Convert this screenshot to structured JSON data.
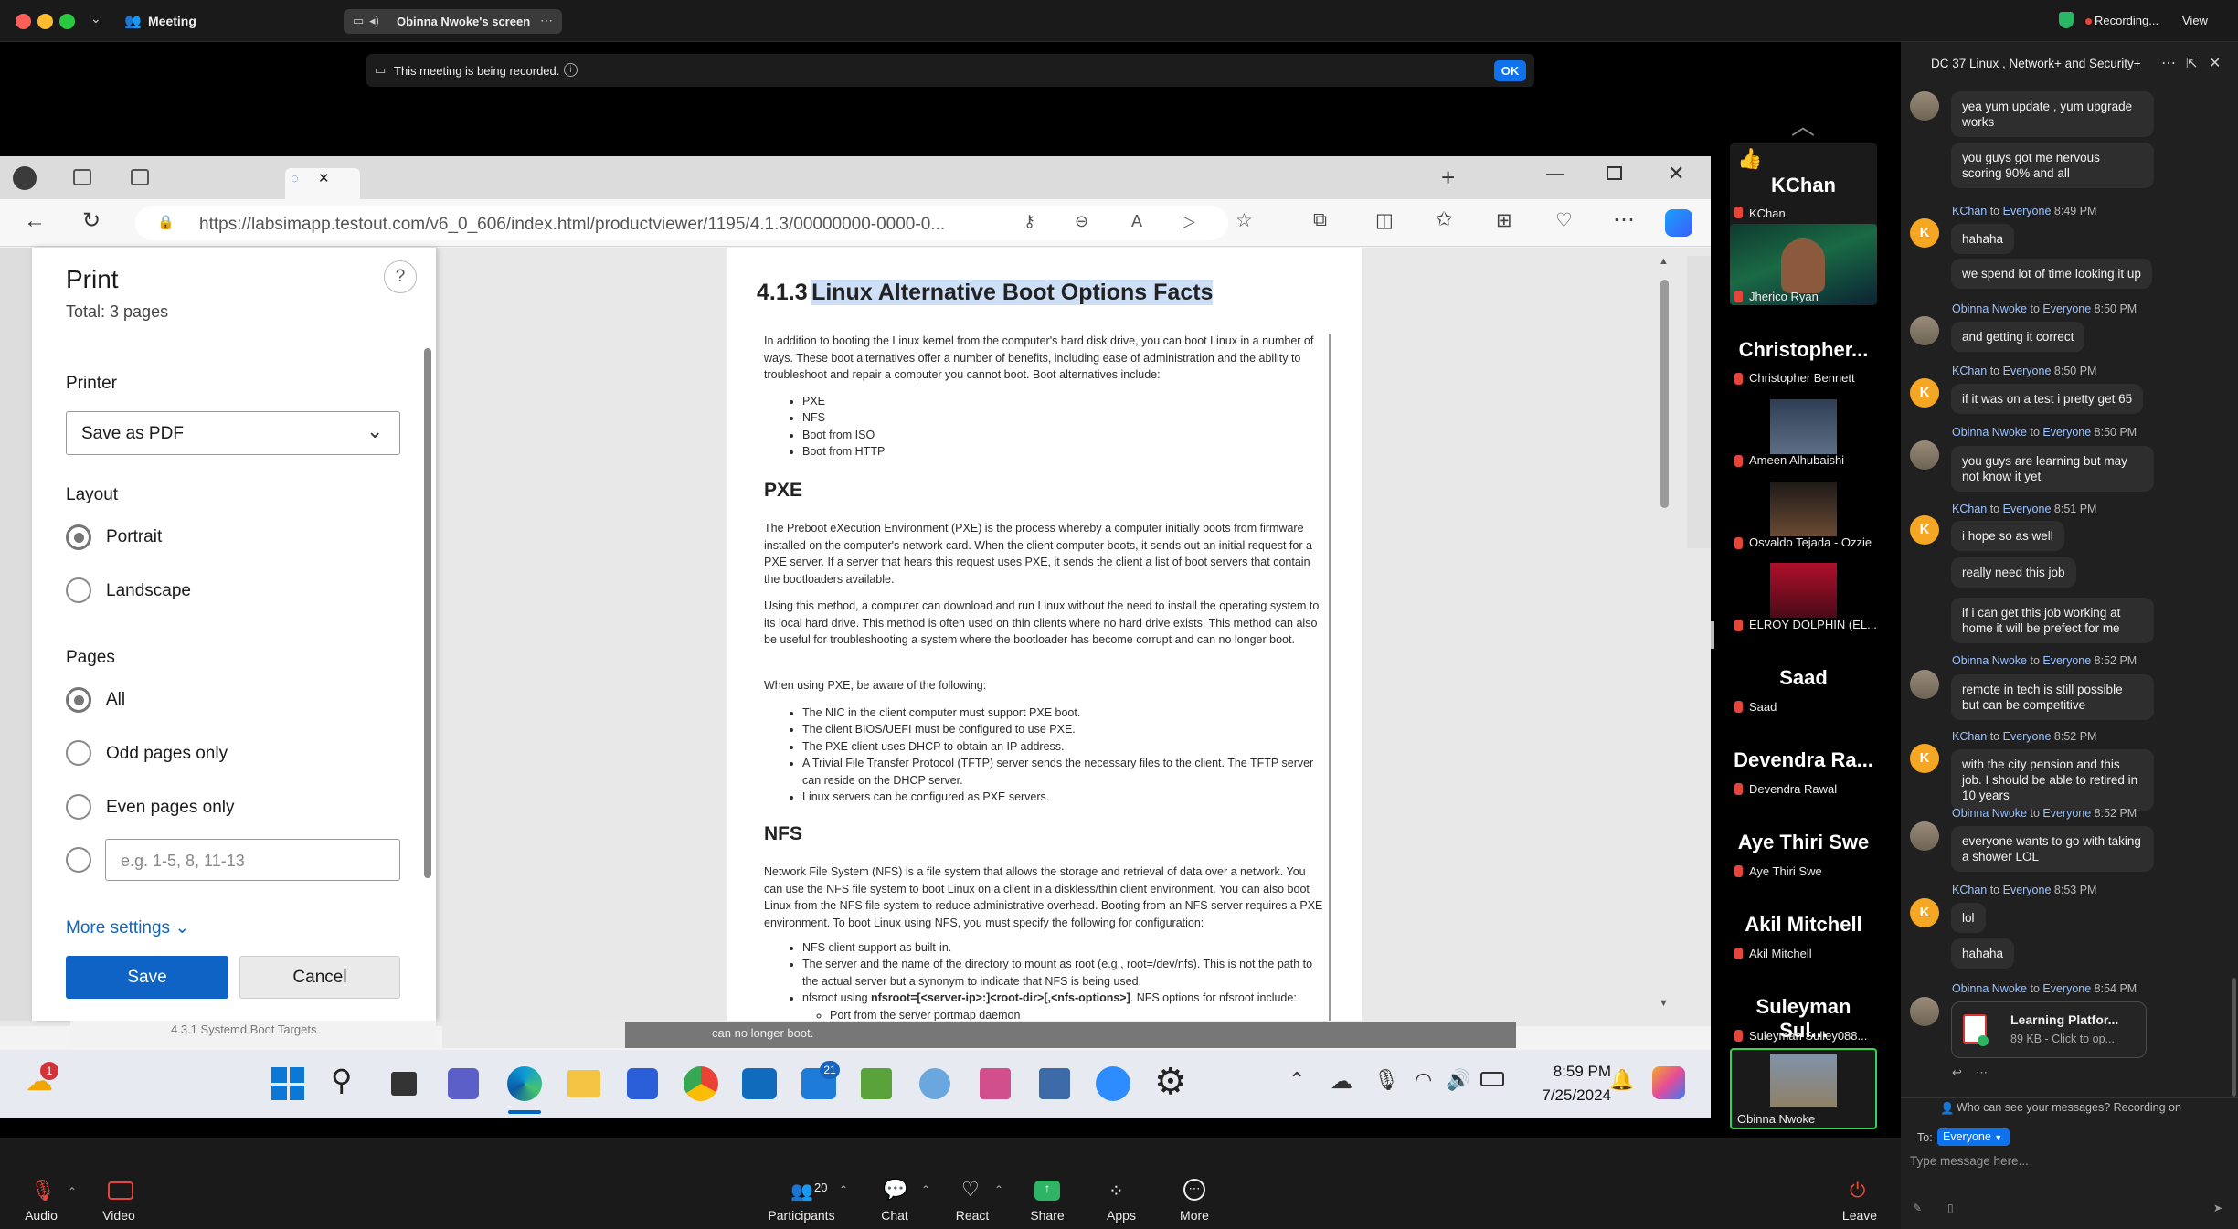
{
  "topbar": {
    "title": "Meeting",
    "share_label": "Obinna Nwoke's screen",
    "recording": "Recording...",
    "view": "View"
  },
  "banner": {
    "text": "This meeting is being recorded.",
    "ok": "OK"
  },
  "browser": {
    "url": "https://labsimapp.testout.com/v6_0_606/index.html/productviewer/1195/4.1.3/00000000-0000-0..."
  },
  "print": {
    "title": "Print",
    "total": "Total: 3 pages",
    "printer_label": "Printer",
    "printer_value": "Save as PDF",
    "layout_label": "Layout",
    "portrait": "Portrait",
    "landscape": "Landscape",
    "pages_label": "Pages",
    "all": "All",
    "odd": "Odd pages only",
    "even": "Even pages only",
    "custom_placeholder": "e.g. 1-5, 8, 11-13",
    "more": "More settings",
    "save": "Save",
    "cancel": "Cancel"
  },
  "doc": {
    "heading_num": "4.1.3",
    "heading": "Linux Alternative Boot Options Facts",
    "intro": "In addition to booting the Linux kernel from the computer's hard disk drive, you can boot Linux in a number of ways. These boot alternatives offer a number of benefits, including ease of administration and the ability to troubleshoot and repair a computer you cannot boot. Boot alternatives include:",
    "intro_list": [
      "PXE",
      "NFS",
      "Boot from ISO",
      "Boot from HTTP"
    ],
    "pxe_h": "PXE",
    "pxe_p1": "The Preboot eXecution Environment (PXE) is the process whereby a computer initially boots from firmware installed on the computer's network card. When the client computer boots, it sends out an initial request for a PXE server. If a server that hears this request uses PXE, it sends the client a list of boot servers that contain the bootloaders available.",
    "pxe_p2": "Using this method, a computer can download and run Linux without the need to install the operating system to its local hard drive. This method is often used on thin clients where no hard drive exists. This method can also be useful for troubleshooting a system where the bootloader has become corrupt and can no longer boot.",
    "pxe_p3": "When using PXE, be aware of the following:",
    "pxe_list": [
      "The NIC in the client computer must support PXE boot.",
      "The client BIOS/UEFI must be configured to use PXE.",
      "The PXE client uses DHCP to obtain an IP address.",
      "A Trivial File Transfer Protocol (TFTP) server sends the necessary files to the client. The TFTP server can reside on the DHCP server.",
      "Linux servers can be configured as PXE servers."
    ],
    "nfs_h": "NFS",
    "nfs_p1": "Network File System (NFS) is a file system that allows the storage and retrieval of data over a network. You can use the NFS file system to boot Linux on a client in a diskless/thin client environment. You can also boot Linux from the NFS file system to reduce administrative overhead. Booting from an NFS server requires a PXE environment. To boot Linux using NFS, you must specify the following for configuration:",
    "nfs_list1": "NFS client support as built-in.",
    "nfs_list2": "The server and the name of the directory to mount as root (e.g., root=/dev/nfs). This is not the path to the actual server but a synonym to indicate that NFS is being used.",
    "nfs_list3a": "nfsroot using ",
    "nfs_list3b": "nfsroot=[<server-ip>:]<root-dir>[,<nfs-options>]",
    "nfs_list3c": ". NFS options for nfsroot include:",
    "nfs_list4": "Port from the server portmap daemon",
    "under_toc": "4.3.1 Systemd Boot Targets",
    "under_text": "can no longer boot."
  },
  "taskbar": {
    "time": "8:59 PM",
    "date": "7/25/2024",
    "weather_badge": "1",
    "outlook_badge": "21"
  },
  "participants": [
    {
      "big": "KChan",
      "small": "KChan"
    },
    {
      "big": "",
      "small": "Jherico Ryan"
    },
    {
      "big": "Christopher...",
      "small": "Christopher Bennett"
    },
    {
      "big": "",
      "small": "Ameen Alhubaishi"
    },
    {
      "big": "",
      "small": "Osvaldo Tejada - Ozzie"
    },
    {
      "big": "",
      "small": "ELROY DOLPHIN (EL..."
    },
    {
      "big": "Saad",
      "small": "Saad"
    },
    {
      "big": "Devendra Ra...",
      "small": "Devendra Rawal"
    },
    {
      "big": "Aye Thiri Swe",
      "small": "Aye Thiri Swe"
    },
    {
      "big": "Akil Mitchell",
      "small": "Akil Mitchell"
    },
    {
      "big": "Suleyman Sul...",
      "small": "Suleyman Sulley088..."
    },
    {
      "big": "",
      "small": "Obinna Nwoke"
    }
  ],
  "chat": {
    "title": "DC 37 Linux , Network+ and Security+",
    "to_word": "to",
    "messages": [
      {
        "text": "yea yum update , yum upgrade works"
      },
      {
        "text": "you guys got me nervous scoring 90% and all"
      },
      {
        "sender": "KChan",
        "to": "Everyone",
        "time": "8:49 PM",
        "text": "hahaha"
      },
      {
        "text": "we spend lot of time looking it up"
      },
      {
        "sender": "Obinna Nwoke",
        "to": "Everyone",
        "time": "8:50 PM",
        "text": "and getting it correct"
      },
      {
        "sender": "KChan",
        "to": "Everyone",
        "time": "8:50 PM",
        "text": "if it was on a test i pretty get 65"
      },
      {
        "sender": "Obinna Nwoke",
        "to": "Everyone",
        "time": "8:50 PM",
        "text": "you guys are learning but may not know  it yet"
      },
      {
        "sender": "KChan",
        "to": "Everyone",
        "time": "8:51 PM",
        "text": "i  hope so as well"
      },
      {
        "text": "really need this job"
      },
      {
        "text": "if i can get this job working at home it will be prefect for me"
      },
      {
        "sender": "Obinna Nwoke",
        "to": "Everyone",
        "time": "8:52 PM",
        "text": "remote in tech is still possible but can be competitive"
      },
      {
        "sender": "KChan",
        "to": "Everyone",
        "time": "8:52 PM",
        "text": "with the city pension and this job. I should be able to retired in 10 years"
      },
      {
        "sender": "Obinna Nwoke",
        "to": "Everyone",
        "time": "8:52 PM",
        "text": "everyone wants to go with taking a shower LOL"
      },
      {
        "sender": "KChan",
        "to": "Everyone",
        "time": "8:53 PM",
        "text": "lol"
      },
      {
        "text": "hahaha"
      },
      {
        "sender": "Obinna Nwoke",
        "to": "Everyone",
        "time": "8:54 PM"
      }
    ],
    "file_name": "Learning Platfor...",
    "file_meta": "89 KB - Click to op...",
    "privacy": "Who can see your messages? Recording on",
    "to_label": "To:",
    "to_value": "Everyone",
    "placeholder": "Type message here..."
  },
  "zoombar": {
    "audio": "Audio",
    "video": "Video",
    "participants": "Participants",
    "participants_count": "20",
    "chat": "Chat",
    "react": "React",
    "share": "Share",
    "apps": "Apps",
    "more": "More",
    "leave": "Leave"
  }
}
